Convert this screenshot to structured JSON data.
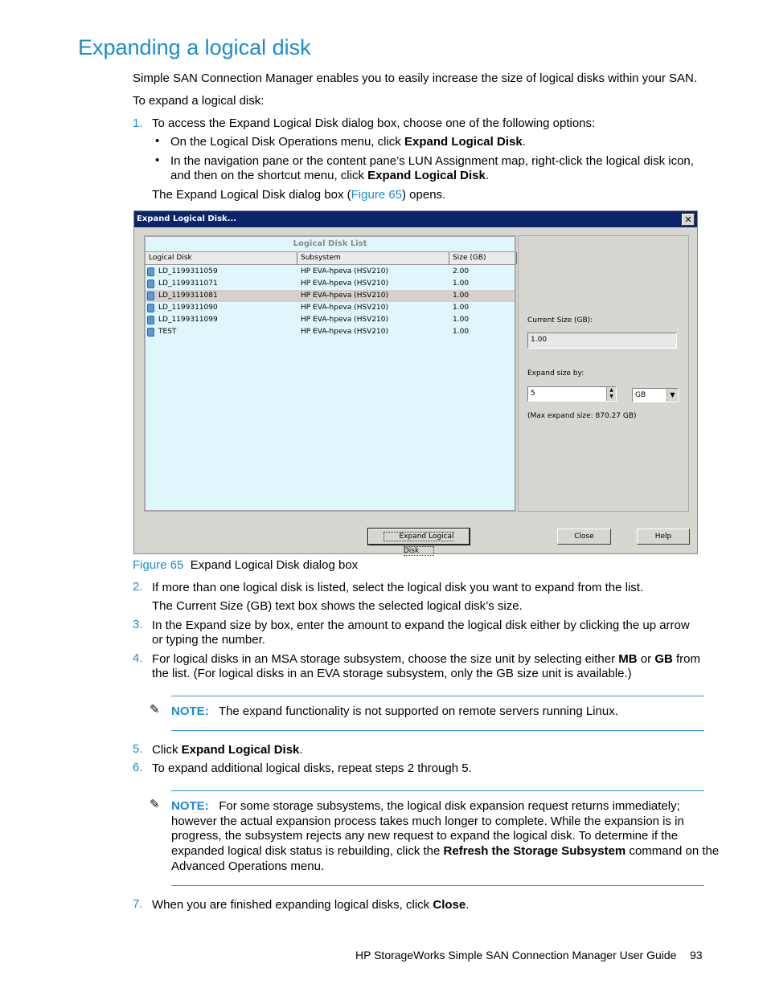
{
  "heading": "Expanding a logical disk",
  "intro": "Simple SAN Connection Manager enables you to easily increase the size of logical disks within your SAN.",
  "to_expand": "To expand a logical disk:",
  "steps": {
    "s1_num": "1.",
    "s1_text": "To access the Expand Logical Disk dialog box, choose one of the following options:",
    "s1_b1_pre": "On the Logical Disk Operations menu, click ",
    "s1_b1_bold": "Expand Logical Disk",
    "s1_b1_post": ".",
    "s1_b2_line1": "In the navigation pane or the content pane’s LUN Assignment map, right-click the logical disk icon,",
    "s1_b2_line2_pre": "and then on the shortcut menu, click ",
    "s1_b2_line2_bold": "Expand Logical Disk",
    "s1_b2_line2_post": ".",
    "s1_after_pre": "The Expand Logical Disk dialog box (",
    "s1_after_link": "Figure 65",
    "s1_after_post": ") opens.",
    "s2_num": "2.",
    "s2_text": "If more than one logical disk is listed, select the logical disk you want to expand from the list.",
    "s2_after": "The Current Size (GB) text box shows the selected logical disk’s size.",
    "s3_num": "3.",
    "s3_line1": "In the Expand size by box, enter the amount to expand the logical disk either by clicking the up arrow",
    "s3_line2": "or typing the number.",
    "s4_num": "4.",
    "s4_line1_pre": "For logical disks in an MSA storage subsystem, choose the size unit by selecting either ",
    "s4_mb": "MB",
    "s4_or": " or ",
    "s4_gb": "GB",
    "s4_line1_post": " from",
    "s4_line2": "the list. (For logical disks in an EVA storage subsystem, only the GB size unit is available.)",
    "s5_num": "5.",
    "s5_pre": "Click ",
    "s5_bold": "Expand Logical Disk",
    "s5_post": ".",
    "s6_num": "6.",
    "s6_text": "To expand additional logical disks, repeat steps 2 through 5.",
    "s7_num": "7.",
    "s7_pre": "When you are finished expanding logical disks, click ",
    "s7_bold": "Close",
    "s7_post": "."
  },
  "note1": {
    "label": "NOTE:",
    "text": "The expand functionality is not supported on remote servers running Linux."
  },
  "note2": {
    "label": "NOTE:",
    "line1": "For some storage subsystems, the logical disk expansion request returns immediately;",
    "line2": "however the actual expansion process takes much longer to complete. While the expansion is in",
    "line3": "progress, the subsystem rejects any new request to expand the logical disk. To determine if the",
    "line4_pre": "expanded logical disk status is rebuilding, click the ",
    "line4_bold": "Refresh the Storage Subsystem",
    "line4_post": " command on the",
    "line5": "Advanced Operations menu."
  },
  "figure": {
    "label": "Figure 65",
    "caption": "Expand Logical Disk dialog box"
  },
  "dialog": {
    "title": "Expand Logical Disk...",
    "close_glyph": "✕",
    "list_title": "Logical Disk List",
    "columns": [
      "Logical Disk",
      "Subsystem",
      "Size (GB)"
    ],
    "rows": [
      {
        "disk": "LD_1199311059",
        "subsystem": "HP EVA-hpeva (HSV210)",
        "size": "2.00"
      },
      {
        "disk": "LD_1199311071",
        "subsystem": "HP EVA-hpeva (HSV210)",
        "size": "1.00"
      },
      {
        "disk": "LD_1199311081",
        "subsystem": "HP EVA-hpeva (HSV210)",
        "size": "1.00",
        "selected": true
      },
      {
        "disk": "LD_1199311090",
        "subsystem": "HP EVA-hpeva (HSV210)",
        "size": "1.00"
      },
      {
        "disk": "LD_1199311099",
        "subsystem": "HP EVA-hpeva (HSV210)",
        "size": "1.00"
      },
      {
        "disk": "TEST",
        "subsystem": "HP EVA-hpeva (HSV210)",
        "size": "1.00"
      }
    ],
    "current_size_label": "Current Size (GB):",
    "current_size_value": "1.00",
    "expand_by_label": "Expand size by:",
    "expand_by_value": "5",
    "unit_value": "GB",
    "max_expand": "(Max expand size: 870.27 GB)",
    "expand_button": "Expand Logical Disk",
    "close_button": "Close",
    "help_button": "Help"
  },
  "footer": {
    "guide": "HP StorageWorks Simple SAN Connection Manager User Guide",
    "page": "93"
  },
  "colors": {
    "accent": "#1a8bd0",
    "dialog_titlebar": "#0a246a",
    "list_bg": "#dff7fb"
  }
}
